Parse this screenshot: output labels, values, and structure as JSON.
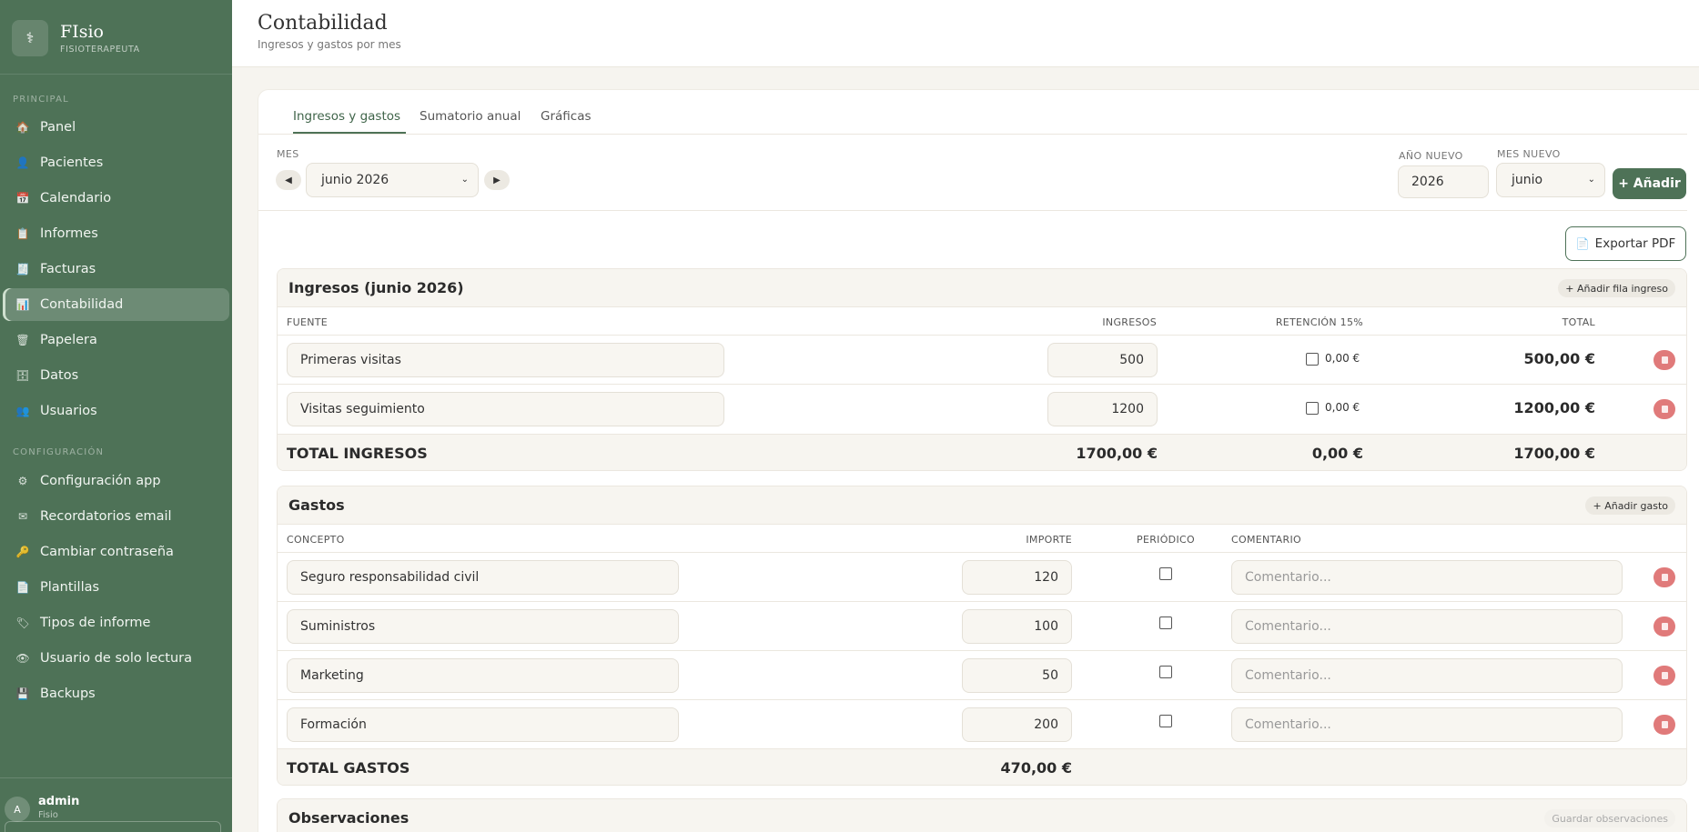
{
  "sidebar": {
    "brand": {
      "logo_glyph": "⚕",
      "name": "FIsio",
      "subtitle": "FISIOTERAPEUTA"
    },
    "sections": [
      {
        "label": "PRINCIPAL",
        "items": [
          {
            "label": "Panel",
            "icon": "house-icon",
            "glyph": "🏠"
          },
          {
            "label": "Pacientes",
            "icon": "person-icon",
            "glyph": "👤"
          },
          {
            "label": "Calendario",
            "icon": "calendar-icon",
            "glyph": "📅"
          },
          {
            "label": "Informes",
            "icon": "clipboard-icon",
            "glyph": "📋"
          },
          {
            "label": "Facturas",
            "icon": "receipt-icon",
            "glyph": "🧾"
          },
          {
            "label": "Contabilidad",
            "icon": "chart-icon",
            "glyph": "📊",
            "active": true
          },
          {
            "label": "Papelera",
            "icon": "trash-icon",
            "glyph": "🗑"
          },
          {
            "label": "Datos",
            "icon": "database-icon",
            "glyph": "🗄"
          },
          {
            "label": "Usuarios",
            "icon": "users-icon",
            "glyph": "👥"
          }
        ]
      },
      {
        "label": "CONFIGURACIÓN",
        "items": [
          {
            "label": "Configuración app",
            "icon": "gear-icon",
            "glyph": "⚙"
          },
          {
            "label": "Recordatorios email",
            "icon": "mail-icon",
            "glyph": "✉"
          },
          {
            "label": "Cambiar contraseña",
            "icon": "key-icon",
            "glyph": "🔑"
          },
          {
            "label": "Plantillas",
            "icon": "template-icon",
            "glyph": "📄"
          },
          {
            "label": "Tipos de informe",
            "icon": "tag-icon",
            "glyph": "🏷"
          },
          {
            "label": "Usuario de solo lectura",
            "icon": "eye-icon",
            "glyph": "👁"
          },
          {
            "label": "Backups",
            "icon": "floppy-icon",
            "glyph": "💾"
          }
        ]
      }
    ],
    "user": {
      "initial": "A",
      "name": "admin",
      "role": "Fisio"
    }
  },
  "header": {
    "title": "Contabilidad",
    "subtitle": "Ingresos y gastos por mes"
  },
  "tabs": [
    {
      "label": "Ingresos y gastos",
      "active": true
    },
    {
      "label": "Sumatorio anual"
    },
    {
      "label": "Gráficas"
    }
  ],
  "controls": {
    "mes_label": "MES",
    "prev_glyph": "◀",
    "next_glyph": "▶",
    "month_value": "junio 2026",
    "anio_nuevo_label": "AÑO NUEVO",
    "anio_nuevo_value": "2026",
    "mes_nuevo_label": "MES NUEVO",
    "mes_nuevo_value": "junio",
    "add_button": "+ Añadir",
    "export_button": "Exportar PDF",
    "export_glyph": "📄"
  },
  "ingresos": {
    "title": "Ingresos (junio 2026)",
    "add_row": "+ Añadir fila ingreso",
    "columns": {
      "fuente": "FUENTE",
      "ingresos": "INGRESOS",
      "retencion": "RETENCIÓN 15%",
      "total": "TOTAL"
    },
    "rows": [
      {
        "fuente": "Primeras visitas",
        "ingresos": "500",
        "retencion": "0,00 €",
        "total": "500,00 €"
      },
      {
        "fuente": "Visitas seguimiento",
        "ingresos": "1200",
        "retencion": "0,00 €",
        "total": "1200,00 €"
      }
    ],
    "total": {
      "label": "TOTAL INGRESOS",
      "ingresos": "1700,00 €",
      "retencion": "0,00 €",
      "total": "1700,00 €"
    }
  },
  "gastos": {
    "title": "Gastos",
    "add_row": "+ Añadir gasto",
    "columns": {
      "concepto": "CONCEPTO",
      "importe": "IMPORTE",
      "periodico": "PERIÓDICO",
      "comentario": "COMENTARIO"
    },
    "comment_placeholder": "Comentario...",
    "rows": [
      {
        "concepto": "Seguro responsabilidad civil",
        "importe": "120"
      },
      {
        "concepto": "Suministros",
        "importe": "100"
      },
      {
        "concepto": "Marketing",
        "importe": "50"
      },
      {
        "concepto": "Formación",
        "importe": "200"
      }
    ],
    "total": {
      "label": "TOTAL GASTOS",
      "importe": "470,00 €"
    }
  },
  "observaciones": {
    "title": "Observaciones",
    "save": "Guardar observaciones"
  }
}
